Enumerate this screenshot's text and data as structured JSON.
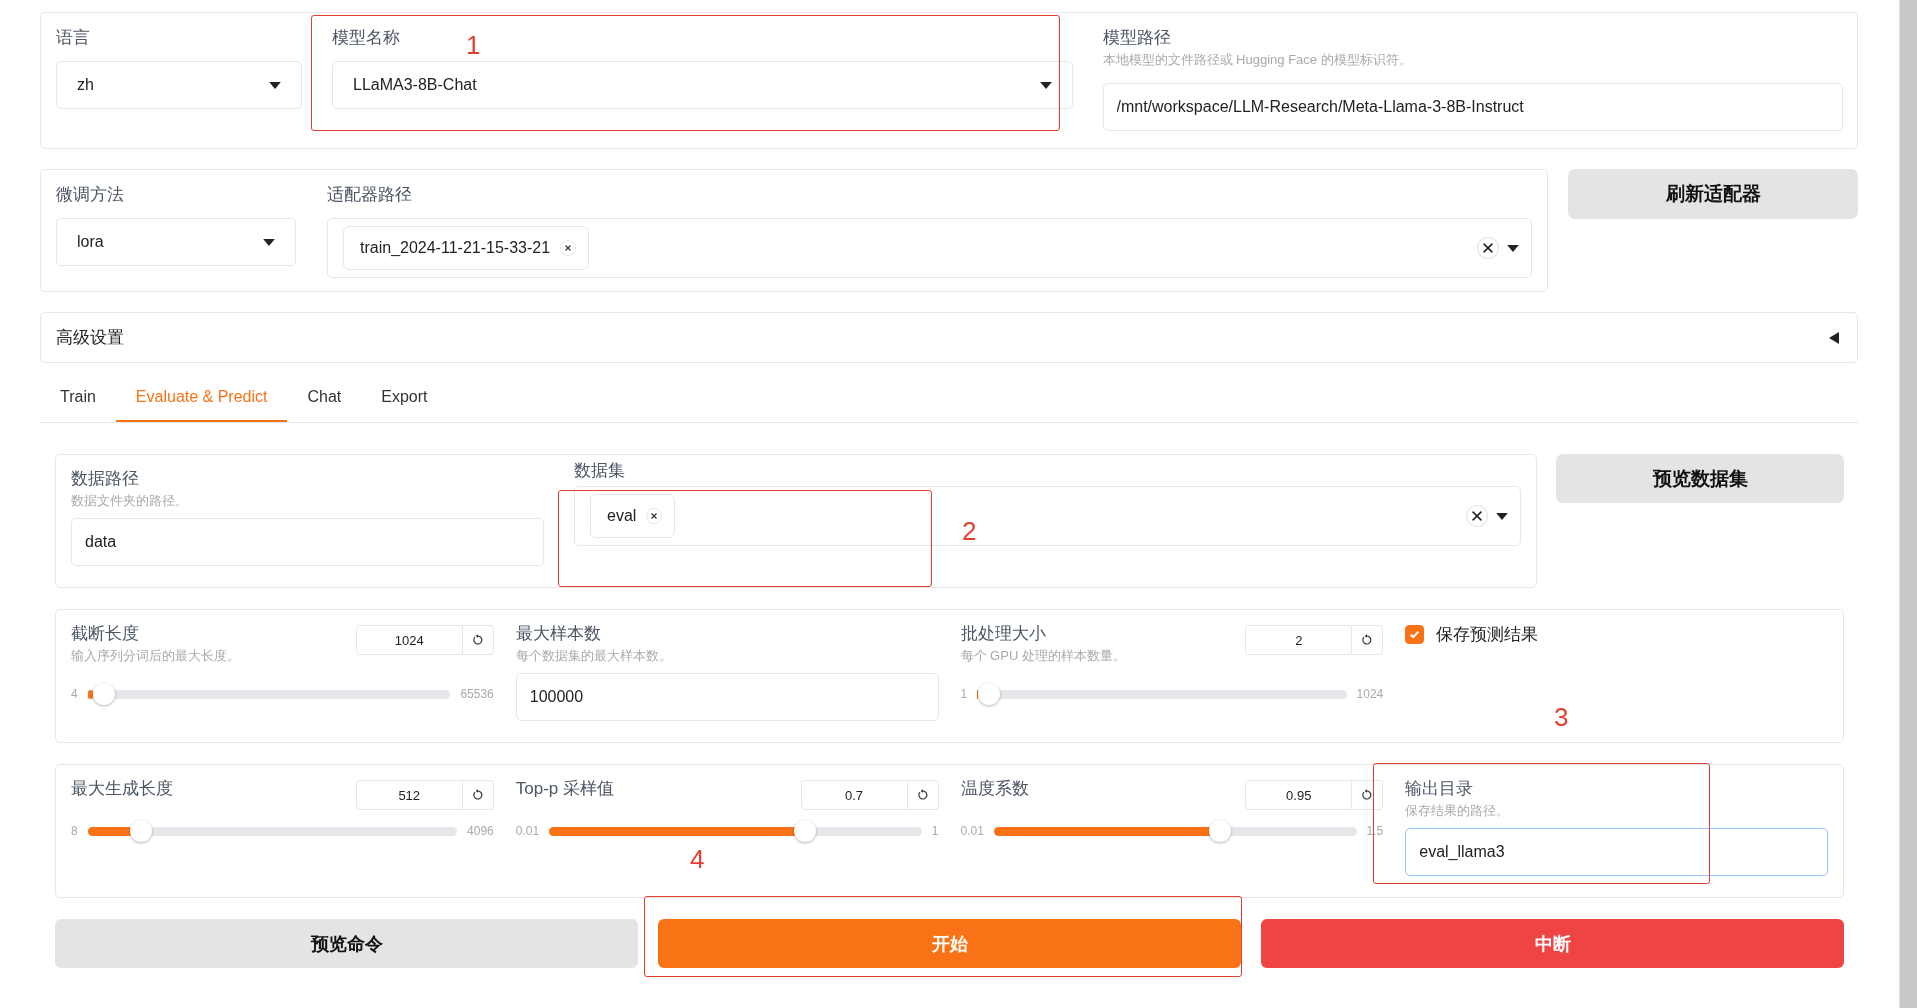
{
  "model_settings": {
    "language": {
      "label": "语言",
      "value": "zh"
    },
    "model_name": {
      "label": "模型名称",
      "value": "LLaMA3-8B-Chat"
    },
    "model_path": {
      "label": "模型路径",
      "info": "本地模型的文件路径或 Hugging Face 的模型标识符。",
      "value": "/mnt/workspace/LLM-Research/Meta-Llama-3-8B-Instruct"
    }
  },
  "adapter_settings": {
    "finetuning_method": {
      "label": "微调方法",
      "value": "lora"
    },
    "adapter_path": {
      "label": "适配器路径",
      "tags": [
        "train_2024-11-21-15-33-21"
      ]
    },
    "refresh_button": "刷新适配器"
  },
  "advanced_settings": {
    "label": "高级设置",
    "expanded": false
  },
  "tabs": [
    {
      "label": "Train",
      "selected": false
    },
    {
      "label": "Evaluate & Predict",
      "selected": true
    },
    {
      "label": "Chat",
      "selected": false
    },
    {
      "label": "Export",
      "selected": false
    }
  ],
  "dataset": {
    "data_path": {
      "label": "数据路径",
      "info": "数据文件夹的路径。",
      "value": "data"
    },
    "dataset": {
      "label": "数据集",
      "tags": [
        "eval"
      ]
    },
    "preview_button": "预览数据集"
  },
  "param_rows": [
    [
      {
        "kind": "slider",
        "label": "截断长度",
        "info": "输入序列分词后的最大长度。",
        "value": "1024",
        "min": "4",
        "max": "65536",
        "level": 0.015
      },
      {
        "kind": "input",
        "label": "最大样本数",
        "info": "每个数据集的最大样本数。",
        "value": "100000",
        "focused": false
      },
      {
        "kind": "slider",
        "label": "批处理大小",
        "info": "每个 GPU 处理的样本数量。",
        "value": "2",
        "min": "1",
        "max": "1024",
        "level": 0.001
      },
      {
        "kind": "checkbox",
        "label": "保存预测结果",
        "checked": true
      }
    ],
    [
      {
        "kind": "slider",
        "label": "最大生成长度",
        "value": "512",
        "min": "8",
        "max": "4096",
        "level": 0.123
      },
      {
        "kind": "slider",
        "label": "Top-p 采样值",
        "value": "0.7",
        "min": "0.01",
        "max": "1",
        "level": 0.697
      },
      {
        "kind": "slider",
        "label": "温度系数",
        "value": "0.95",
        "min": "0.01",
        "max": "1.5",
        "level": 0.631
      },
      {
        "kind": "input",
        "label": "输出目录",
        "info": "保存结果的路径。",
        "value": "eval_llama3",
        "focused": true
      }
    ]
  ],
  "buttons": [
    {
      "label": "预览命令",
      "kind": "secondary"
    },
    {
      "label": "开始",
      "kind": "primary"
    },
    {
      "label": "中断",
      "kind": "stop"
    }
  ],
  "annotations": [
    {
      "label": "1"
    },
    {
      "label": "2"
    },
    {
      "label": "3"
    },
    {
      "label": "4"
    }
  ]
}
